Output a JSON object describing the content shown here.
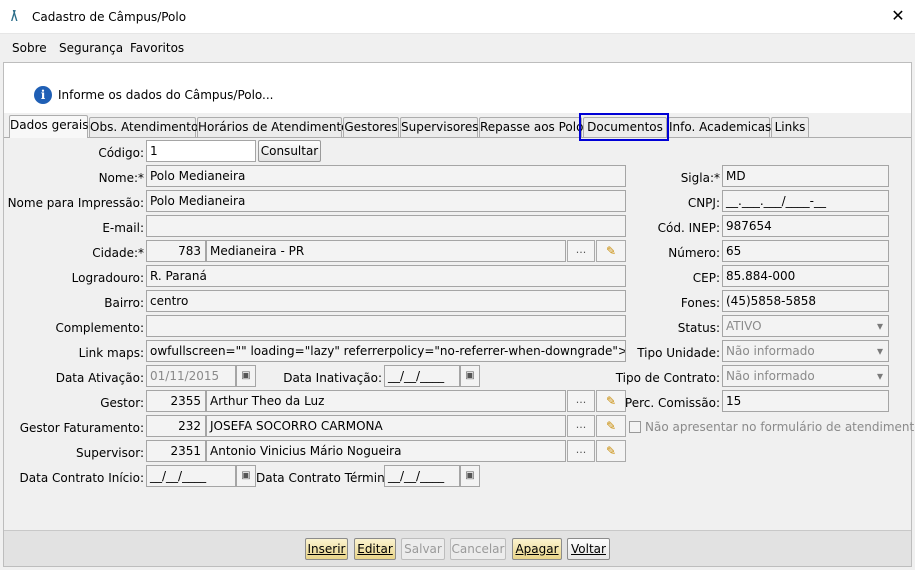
{
  "window": {
    "logo": "/\\",
    "title": "Cadastro de Câmpus/Polo",
    "close": "✕"
  },
  "menu": [
    "Sobre",
    "Segurança",
    "Favoritos"
  ],
  "info": {
    "icon": "i",
    "text": "Informe os dados do Câmpus/Polo..."
  },
  "tabs": [
    "Dados gerais",
    "Obs. Atendimento",
    "Horários de Atendimento",
    "Gestores",
    "Supervisores",
    "Repasse aos Polos",
    "Documentos",
    "Info. Academicas",
    "Links"
  ],
  "form": {
    "codigo_label": "Código:",
    "codigo_value": "1",
    "consultar": "Consultar",
    "nome_label": "Nome:*",
    "nome_value": "Polo Medianeira",
    "impressao_label": "Nome para Impressão:",
    "impressao_value": "Polo Medianeira",
    "email_label": "E-mail:",
    "email_value": "",
    "cidade_label": "Cidade:*",
    "cidade_code": "783",
    "cidade_value": "Medianeira - PR",
    "logradouro_label": "Logradouro:",
    "logradouro_value": "R. Paraná",
    "bairro_label": "Bairro:",
    "bairro_value": "centro",
    "complemento_label": "Complemento:",
    "complemento_value": "",
    "linkmaps_label": "Link maps:",
    "linkmaps_value": "owfullscreen=\"\" loading=\"lazy\" referrerpolicy=\"no-referrer-when-downgrade\"></iframe>",
    "data_ativacao_label": "Data Ativação:",
    "data_ativacao_value": "01/11/2015",
    "data_inativacao_label": "Data Inativação:",
    "data_inativacao_value": "__/__/____",
    "gestor_label": "Gestor:",
    "gestor_code": "2355",
    "gestor_value": "Arthur Theo da Luz",
    "gestor_fat_label": "Gestor Faturamento:",
    "gestor_fat_code": "232",
    "gestor_fat_value": "JOSEFA SOCORRO CARMONA",
    "supervisor_label": "Supervisor:",
    "supervisor_code": "2351",
    "supervisor_value": "Antonio Vinicius Mário Nogueira",
    "contrato_inicio_label": "Data Contrato Início:",
    "contrato_inicio_value": "__/__/____",
    "contrato_termino_label": "Data Contrato Término:",
    "contrato_termino_value": "__/__/____",
    "sigla_label": "Sigla:*",
    "sigla_value": "MD",
    "cnpj_label": "CNPJ:",
    "cnpj_value": "__.___.___/____-__",
    "inep_label": "Cód. INEP:",
    "inep_value": "987654",
    "numero_label": "Número:",
    "numero_value": "65",
    "cep_label": "CEP:",
    "cep_value": "85.884-000",
    "fones_label": "Fones:",
    "fones_value": "(45)5858-5858",
    "status_label": "Status:",
    "status_value": "ATIVO",
    "tipo_unidade_label": "Tipo Unidade:",
    "tipo_unidade_value": "Não informado",
    "tipo_contrato_label": "Tipo de Contrato:",
    "tipo_contrato_value": "Não informado",
    "perc_label": "Perc. Comissão:",
    "perc_value": "15",
    "nao_apresentar_label": "Não apresentar no formulário de atendimento",
    "dots": "...",
    "edit": "✎",
    "cal": "▣"
  },
  "footer": [
    "Inserir",
    "Editar",
    "Salvar",
    "Cancelar",
    "Apagar",
    "Voltar"
  ]
}
